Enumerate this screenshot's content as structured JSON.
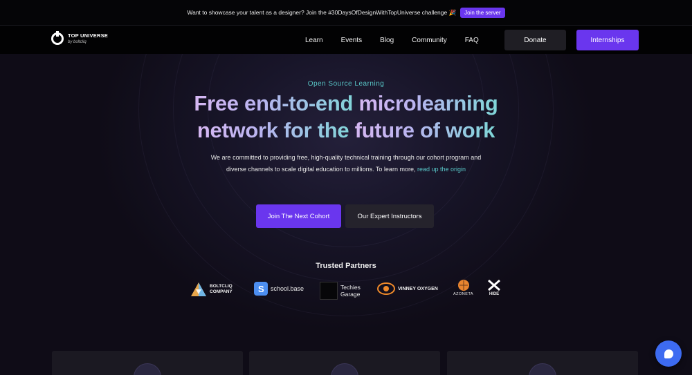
{
  "announcement": {
    "text": "Want to showcase your talent as a designer? Join the #30DaysOfDesignWithTopUniverse challenge 🎉",
    "button": "Join the server"
  },
  "brand": {
    "name": "TOP UNIVERSE",
    "sub": "by boltcliq"
  },
  "nav": {
    "links": [
      "Learn",
      "Events",
      "Blog",
      "Community",
      "FAQ"
    ],
    "donate": "Donate",
    "internships": "Internships"
  },
  "hero": {
    "eyebrow": "Open Source Learning",
    "headline_line1_a": "Free end-to-end ",
    "headline_line1_b": "microlearning",
    "headline_line2_a": "network for the ",
    "headline_line2_b": "future of work",
    "description": "We are committed to providing free, high-quality technical training through our cohort program and diverse channels to scale digital education to millions. To learn more, ",
    "description_link": "read up the origin",
    "primary_cta": "Join The Next Cohort",
    "secondary_cta": "Our Expert Instructors"
  },
  "partners": {
    "title": "Trusted Partners",
    "items": [
      {
        "name": "BOLTCLIQ COMPANY",
        "icon": "boltcliq-logo"
      },
      {
        "name": "school.base",
        "icon": "schoolbase-logo"
      },
      {
        "name": "Techies Garage",
        "icon": "techies-garage-logo"
      },
      {
        "name": "VINNEY OXYGEN",
        "icon": "vinney-oxygen-logo"
      },
      {
        "name": "AZONETA",
        "icon": "azoneta-logo"
      },
      {
        "name": "HIDE",
        "icon": "hide-logo"
      }
    ]
  },
  "colors": {
    "accent": "#6a36ee",
    "teal": "#58c6c7",
    "background": "#0f0c17",
    "chat": "#3d6bf1"
  }
}
